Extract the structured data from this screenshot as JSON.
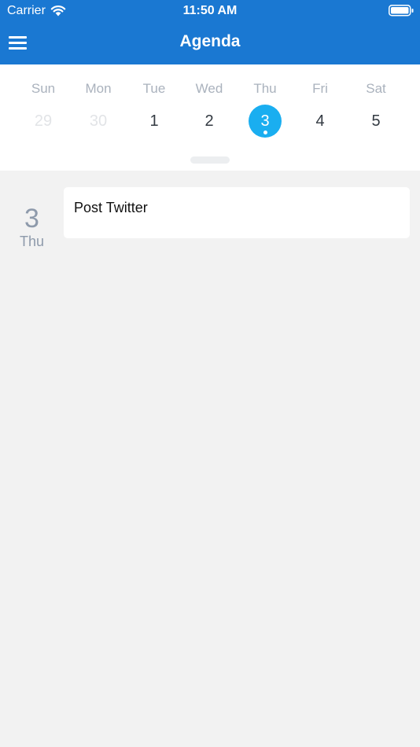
{
  "status": {
    "carrier": "Carrier",
    "time": "11:50 AM",
    "icons": [
      "wifi-icon",
      "battery-icon"
    ]
  },
  "nav": {
    "title": "Agenda",
    "menu_icon": "hamburger-menu-icon"
  },
  "colors": {
    "header": "#1a78d2",
    "selected_date": "#1aaef0",
    "muted_text": "#8e9aab",
    "background": "#f2f2f2"
  },
  "week": {
    "days": [
      {
        "dow": "Sun",
        "date": "29",
        "muted": true
      },
      {
        "dow": "Mon",
        "date": "30",
        "muted": true
      },
      {
        "dow": "Tue",
        "date": "1"
      },
      {
        "dow": "Wed",
        "date": "2"
      },
      {
        "dow": "Thu",
        "date": "3",
        "selected": true
      },
      {
        "dow": "Fri",
        "date": "4"
      },
      {
        "dow": "Sat",
        "date": "5"
      }
    ]
  },
  "agenda": {
    "day_number": "3",
    "day_name": "Thu",
    "events": [
      {
        "title": "Post Twitter"
      }
    ]
  }
}
